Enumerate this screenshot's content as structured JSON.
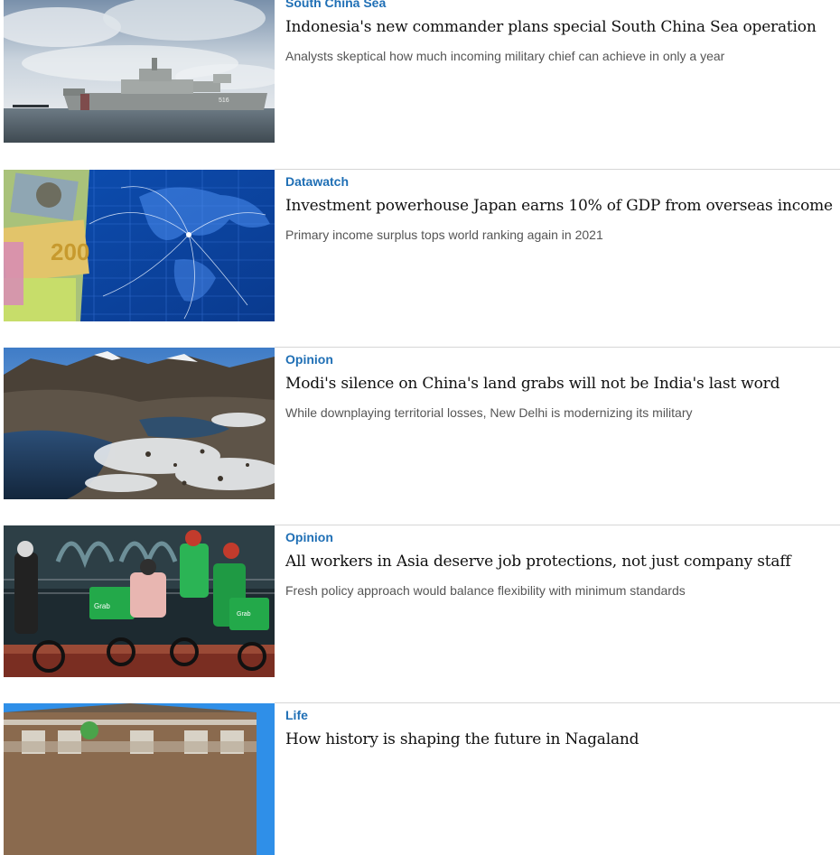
{
  "articles": [
    {
      "category": "South China Sea",
      "headline": "Indonesia's new commander plans special South China Sea operation",
      "summary": "Analysts skeptical how much incoming military chief can achieve in only a year",
      "image": "warship-photo"
    },
    {
      "category": "Datawatch",
      "headline": "Investment powerhouse Japan earns 10% of GDP from overseas income",
      "summary": "Primary income surplus tops world ranking again in 2021",
      "image": "currency-and-world-map-photo"
    },
    {
      "category": "Opinion",
      "headline": "Modi's silence on China's land grabs will not be India's last word",
      "summary": "While downplaying territorial losses, New Delhi is modernizing its military",
      "image": "himalayan-lake-photo"
    },
    {
      "category": "Opinion",
      "headline": "All workers in Asia deserve job protections, not just company staff",
      "summary": "Fresh policy approach would balance flexibility with minimum standards",
      "image": "delivery-riders-photo"
    },
    {
      "category": "Life",
      "headline": "How history is shaping the future in Nagaland",
      "summary": "",
      "image": "wooden-house-photo"
    }
  ]
}
